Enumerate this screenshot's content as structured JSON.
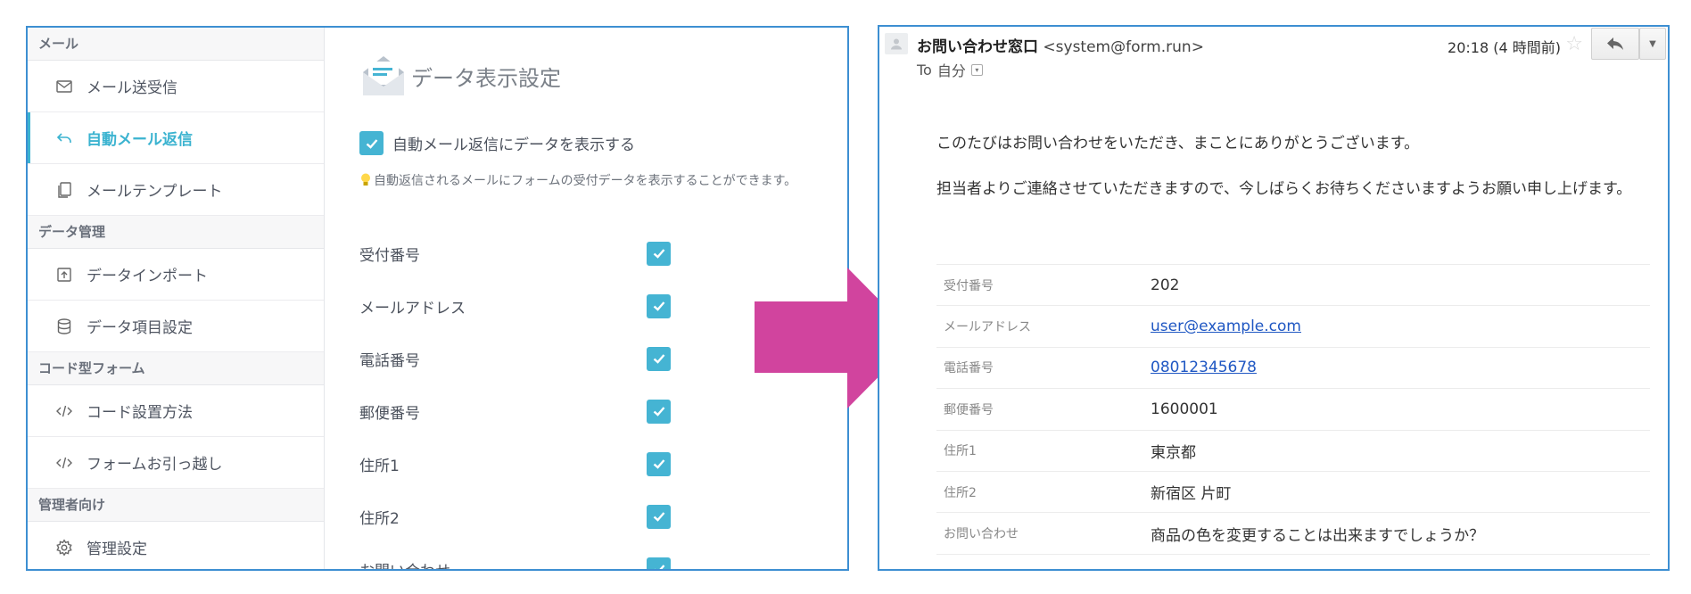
{
  "settings_app": {
    "sidebar": {
      "sections": [
        {
          "title": "メール",
          "items": [
            {
              "label": "メール送受信",
              "icon": "mail-icon",
              "active": false
            },
            {
              "label": "自動メール返信",
              "icon": "reply-icon",
              "active": true
            },
            {
              "label": "メールテンプレート",
              "icon": "copy-icon",
              "active": false
            }
          ]
        },
        {
          "title": "データ管理",
          "items": [
            {
              "label": "データインポート",
              "icon": "upload-icon",
              "active": false
            },
            {
              "label": "データ項目設定",
              "icon": "database-icon",
              "active": false
            }
          ]
        },
        {
          "title": "コード型フォーム",
          "items": [
            {
              "label": "コード設置方法",
              "icon": "code-icon",
              "active": false
            },
            {
              "label": "フォームお引っ越し",
              "icon": "code-icon",
              "active": false
            }
          ]
        },
        {
          "title": "管理者向け",
          "items": [
            {
              "label": "管理設定",
              "icon": "gear-icon",
              "active": false
            }
          ]
        }
      ]
    },
    "panel": {
      "title": "データ表示設定",
      "master_checkbox_label": "自動メール返信にデータを表示する",
      "master_checked": true,
      "hint": "自動返信されるメールにフォームの受付データを表示することができます。",
      "fields": [
        {
          "label": "受付番号",
          "checked": true
        },
        {
          "label": "メールアドレス",
          "checked": true
        },
        {
          "label": "電話番号",
          "checked": true
        },
        {
          "label": "郵便番号",
          "checked": true
        },
        {
          "label": "住所1",
          "checked": true
        },
        {
          "label": "住所2",
          "checked": true
        },
        {
          "label": "お問い合わせ",
          "checked": true
        }
      ]
    }
  },
  "email_preview": {
    "sender_name": "お問い合わせ窓口",
    "sender_email": "<system@form.run>",
    "to_prefix": "To",
    "to_value": "自分",
    "timestamp": "20:18 (4 時間前)",
    "body": [
      "このたびはお問い合わせをいただき、まことにありがとうございます。",
      "担当者よりご連絡させていただきますので、今しばらくお待ちくださいますようお願い申し上げます。"
    ],
    "rows": [
      {
        "label": "受付番号",
        "value": "202",
        "link": false
      },
      {
        "label": "メールアドレス",
        "value": "user@example.com",
        "link": true
      },
      {
        "label": "電話番号",
        "value": "08012345678",
        "link": true
      },
      {
        "label": "郵便番号",
        "value": "1600001",
        "link": false
      },
      {
        "label": "住所1",
        "value": "東京都",
        "link": false
      },
      {
        "label": "住所2",
        "value": "新宿区 片町",
        "link": false
      },
      {
        "label": "お問い合わせ",
        "value": "商品の色を変更することは出来ますでしょうか？",
        "link": false
      }
    ]
  },
  "colors": {
    "accent": "#45b4d3",
    "panel_border": "#3d8fd2",
    "arrow": "#d1449e",
    "link": "#1f57c3"
  }
}
